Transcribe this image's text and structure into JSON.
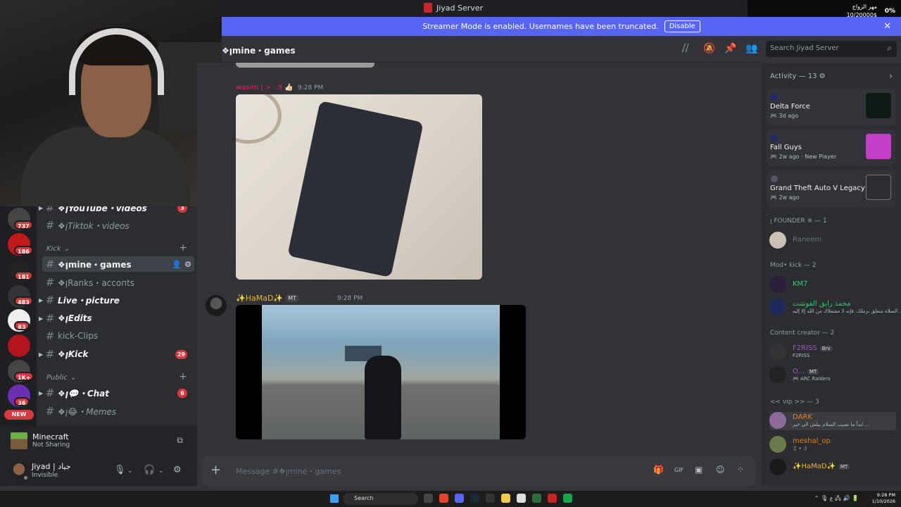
{
  "titlebar": {
    "server_name": "Jiyad Server"
  },
  "notification": {
    "line1": "مهر الزواج",
    "line2": "10/20000$",
    "percent": "0%"
  },
  "banner": {
    "text": "Streamer Mode is enabled. Usernames have been truncated.",
    "button": "Disable"
  },
  "rail": {
    "badges": [
      "737",
      "186",
      "181",
      "483",
      "83",
      "1K+",
      "36"
    ],
    "new_label": "NEW"
  },
  "channels": {
    "items": [
      {
        "name": "❖ꞁYouTube・videos",
        "badge": "3"
      },
      {
        "name": "❖ꞁTiktok・videos"
      },
      {
        "name": "❖ꞁmine・games"
      },
      {
        "name": "❖ꞁRanks・accoпts"
      },
      {
        "name": "Live・picture"
      },
      {
        "name": "❖ꞁEdits"
      },
      {
        "name": "kick-Clips"
      },
      {
        "name": "❖ꞁKick",
        "badge": "29"
      },
      {
        "name": "❖ꞁ💬・Chat",
        "badge": "6"
      },
      {
        "name": "❖ꞁ😂・Memes"
      }
    ],
    "categories": {
      "kick": "Kick",
      "public": "Public"
    }
  },
  "voice": {
    "game": "Minecraft",
    "status": "Not Sharing"
  },
  "user": {
    "name": "Jiyad | جياد",
    "status": "Invisible"
  },
  "chat": {
    "channel_title": "❖ꞁmine・games",
    "search_placeholder": "Search Jiyad Server",
    "msg1": {
      "author": "wasim | > ·.9 👍🏻",
      "time": "9:28 PM"
    },
    "msg2": {
      "author": "✨HaMaD✨",
      "tag": "MT",
      "time": "9:28 PM"
    },
    "composer_placeholder": "Message #❖ꞁmine・games"
  },
  "activity": {
    "header": "Activity — 13",
    "cards": [
      {
        "game": "Delta Force",
        "meta": "3d ago",
        "extra": ""
      },
      {
        "game": "Fall Guys",
        "meta": "2w ago",
        "extra": "New Player"
      },
      {
        "game": "Grand Theft Auto V Legacy",
        "meta": "2w ago",
        "extra": ""
      }
    ]
  },
  "members": {
    "founder_role": "ꞁ FOUNDER ※ — 1",
    "founder_name": "Raneem",
    "mod_role": "Mod• kick — 2",
    "mod1_name": "KM7",
    "mod2_name": "محمد رايق القونتنت",
    "mod2_sub": "الصلاة متعلق برملك، فإنه لا مشغلاك من الله إلا إليه ...",
    "cc_role": "Content creator — 2",
    "cc1_name": "F2RISS",
    "cc1_tag": "Brv",
    "cc1_sub": "F2RISS",
    "cc2_name": "O...",
    "cc2_tag": "MT",
    "cc2_sub": "ARC Raiders",
    "vip_role": "<< vip >> — 3",
    "vip1_name": "DARK",
    "vip1_sub": "ابداً ما تصيب السلام ببلش الى خير ...",
    "vip2_name": "meshal_op",
    "vip2_sub": "♫ • :)",
    "vip3_name": "✨HaMaD✨",
    "vip3_tag": "MT"
  },
  "taskbar": {
    "search": "Search",
    "time": "9:28 PM",
    "date": "1/10/2026"
  },
  "colors": {
    "accent": "#5865f2",
    "badge": "#da373c",
    "bg": "#313338",
    "sidebar": "#2b2d31"
  }
}
